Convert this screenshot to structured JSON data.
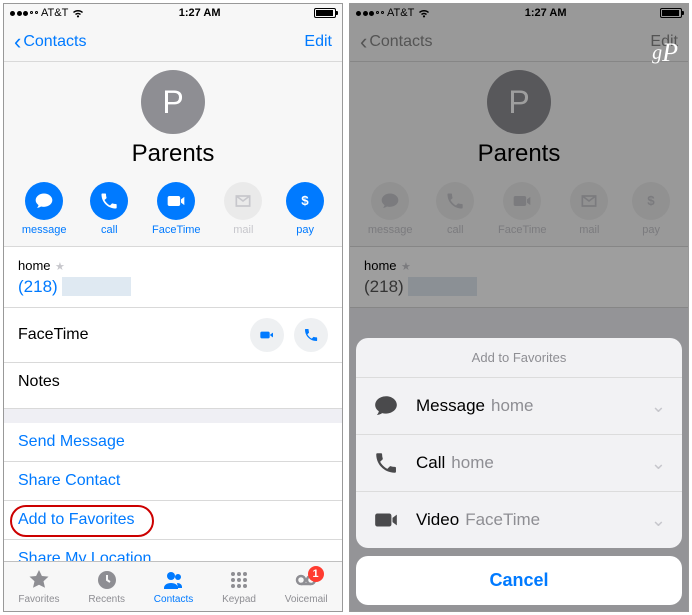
{
  "status": {
    "carrier": "AT&T",
    "time": "1:27 AM"
  },
  "nav": {
    "back_label": "Contacts",
    "edit_label": "Edit"
  },
  "contact": {
    "initial": "P",
    "name": "Parents"
  },
  "actions": {
    "message": "message",
    "call": "call",
    "facetime": "FaceTime",
    "mail": "mail",
    "pay": "pay"
  },
  "phone_row": {
    "label": "home",
    "number_prefix": "(218)"
  },
  "facetime_label": "FaceTime",
  "notes_label": "Notes",
  "links": {
    "send_message": "Send Message",
    "share_contact": "Share Contact",
    "add_favorites": "Add to Favorites",
    "share_location": "Share My Location"
  },
  "tabs": {
    "favorites": "Favorites",
    "recents": "Recents",
    "contacts": "Contacts",
    "keypad": "Keypad",
    "voicemail": "Voicemail",
    "voicemail_badge": "1"
  },
  "sheet": {
    "header": "Add to Favorites",
    "rows": [
      {
        "type": "Message",
        "sub": "home"
      },
      {
        "type": "Call",
        "sub": "home"
      },
      {
        "type": "Video",
        "sub": "FaceTime"
      }
    ],
    "cancel": "Cancel"
  },
  "watermark": "gP"
}
